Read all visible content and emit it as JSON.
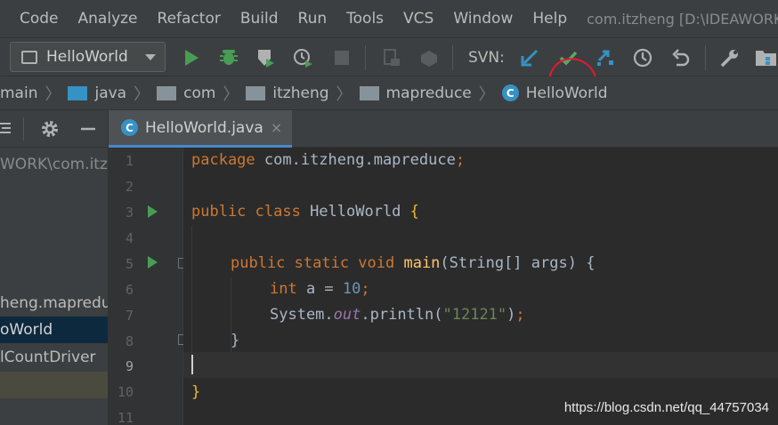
{
  "menu": {
    "items": [
      "Code",
      "Analyze",
      "Refactor",
      "Build",
      "Run",
      "Tools",
      "VCS",
      "Window",
      "Help"
    ],
    "window_title": "com.itzheng [D:\\IDEAWORKS"
  },
  "toolbar": {
    "run_config": "HelloWorld",
    "svn_label": "SVN:",
    "icons": [
      "run-icon",
      "debug-icon",
      "coverage-icon",
      "profile-icon",
      "stop-icon",
      "attach-icon",
      "build-icon",
      "svn-update-icon",
      "svn-commit-icon",
      "svn-compare-icon",
      "history-icon",
      "revert-icon",
      "settings-wrench-icon",
      "project-structure-icon"
    ],
    "colors": {
      "run": "#499C54",
      "commit": "#59A869",
      "update": "#3592C4",
      "annotation": "#E8192C"
    }
  },
  "breadcrumb": {
    "items": [
      "main",
      "java",
      "com",
      "itzheng",
      "mapreduce",
      "HelloWorld"
    ]
  },
  "project": {
    "path_fragment": "WORK\\com.itzh",
    "rows": [
      "heng.mapreduce",
      "oWorld",
      "lCountDriver"
    ]
  },
  "editor": {
    "tab_label": "HelloWorld.java",
    "tab_close": "×",
    "class_badge": "C",
    "line_numbers": [
      "1",
      "2",
      "3",
      "4",
      "5",
      "6",
      "7",
      "8",
      "9",
      "10",
      "11"
    ],
    "lines": {
      "l1_kw": "package",
      "l1_rest": " com.itzheng.mapreduce",
      "l1_semi": ";",
      "l3_kw": "public class",
      "l3_name": " HelloWorld ",
      "l3_brace": "{",
      "l5_kw": "public static void",
      "l5_fn": " main",
      "l5_args": "(String[] args) ",
      "l5_brace": "{",
      "l6_kw": "int",
      "l6_var": " a = ",
      "l6_num": "10",
      "l6_semi": ";",
      "l7_sys": "System.",
      "l7_field": "out",
      "l7_call": ".println(",
      "l7_str": "\"12121\"",
      "l7_end": ")",
      "l7_semi": ";",
      "l8_brace": "}",
      "l10_brace": "}"
    }
  },
  "watermark": "https://blog.csdn.net/qq_44757034"
}
